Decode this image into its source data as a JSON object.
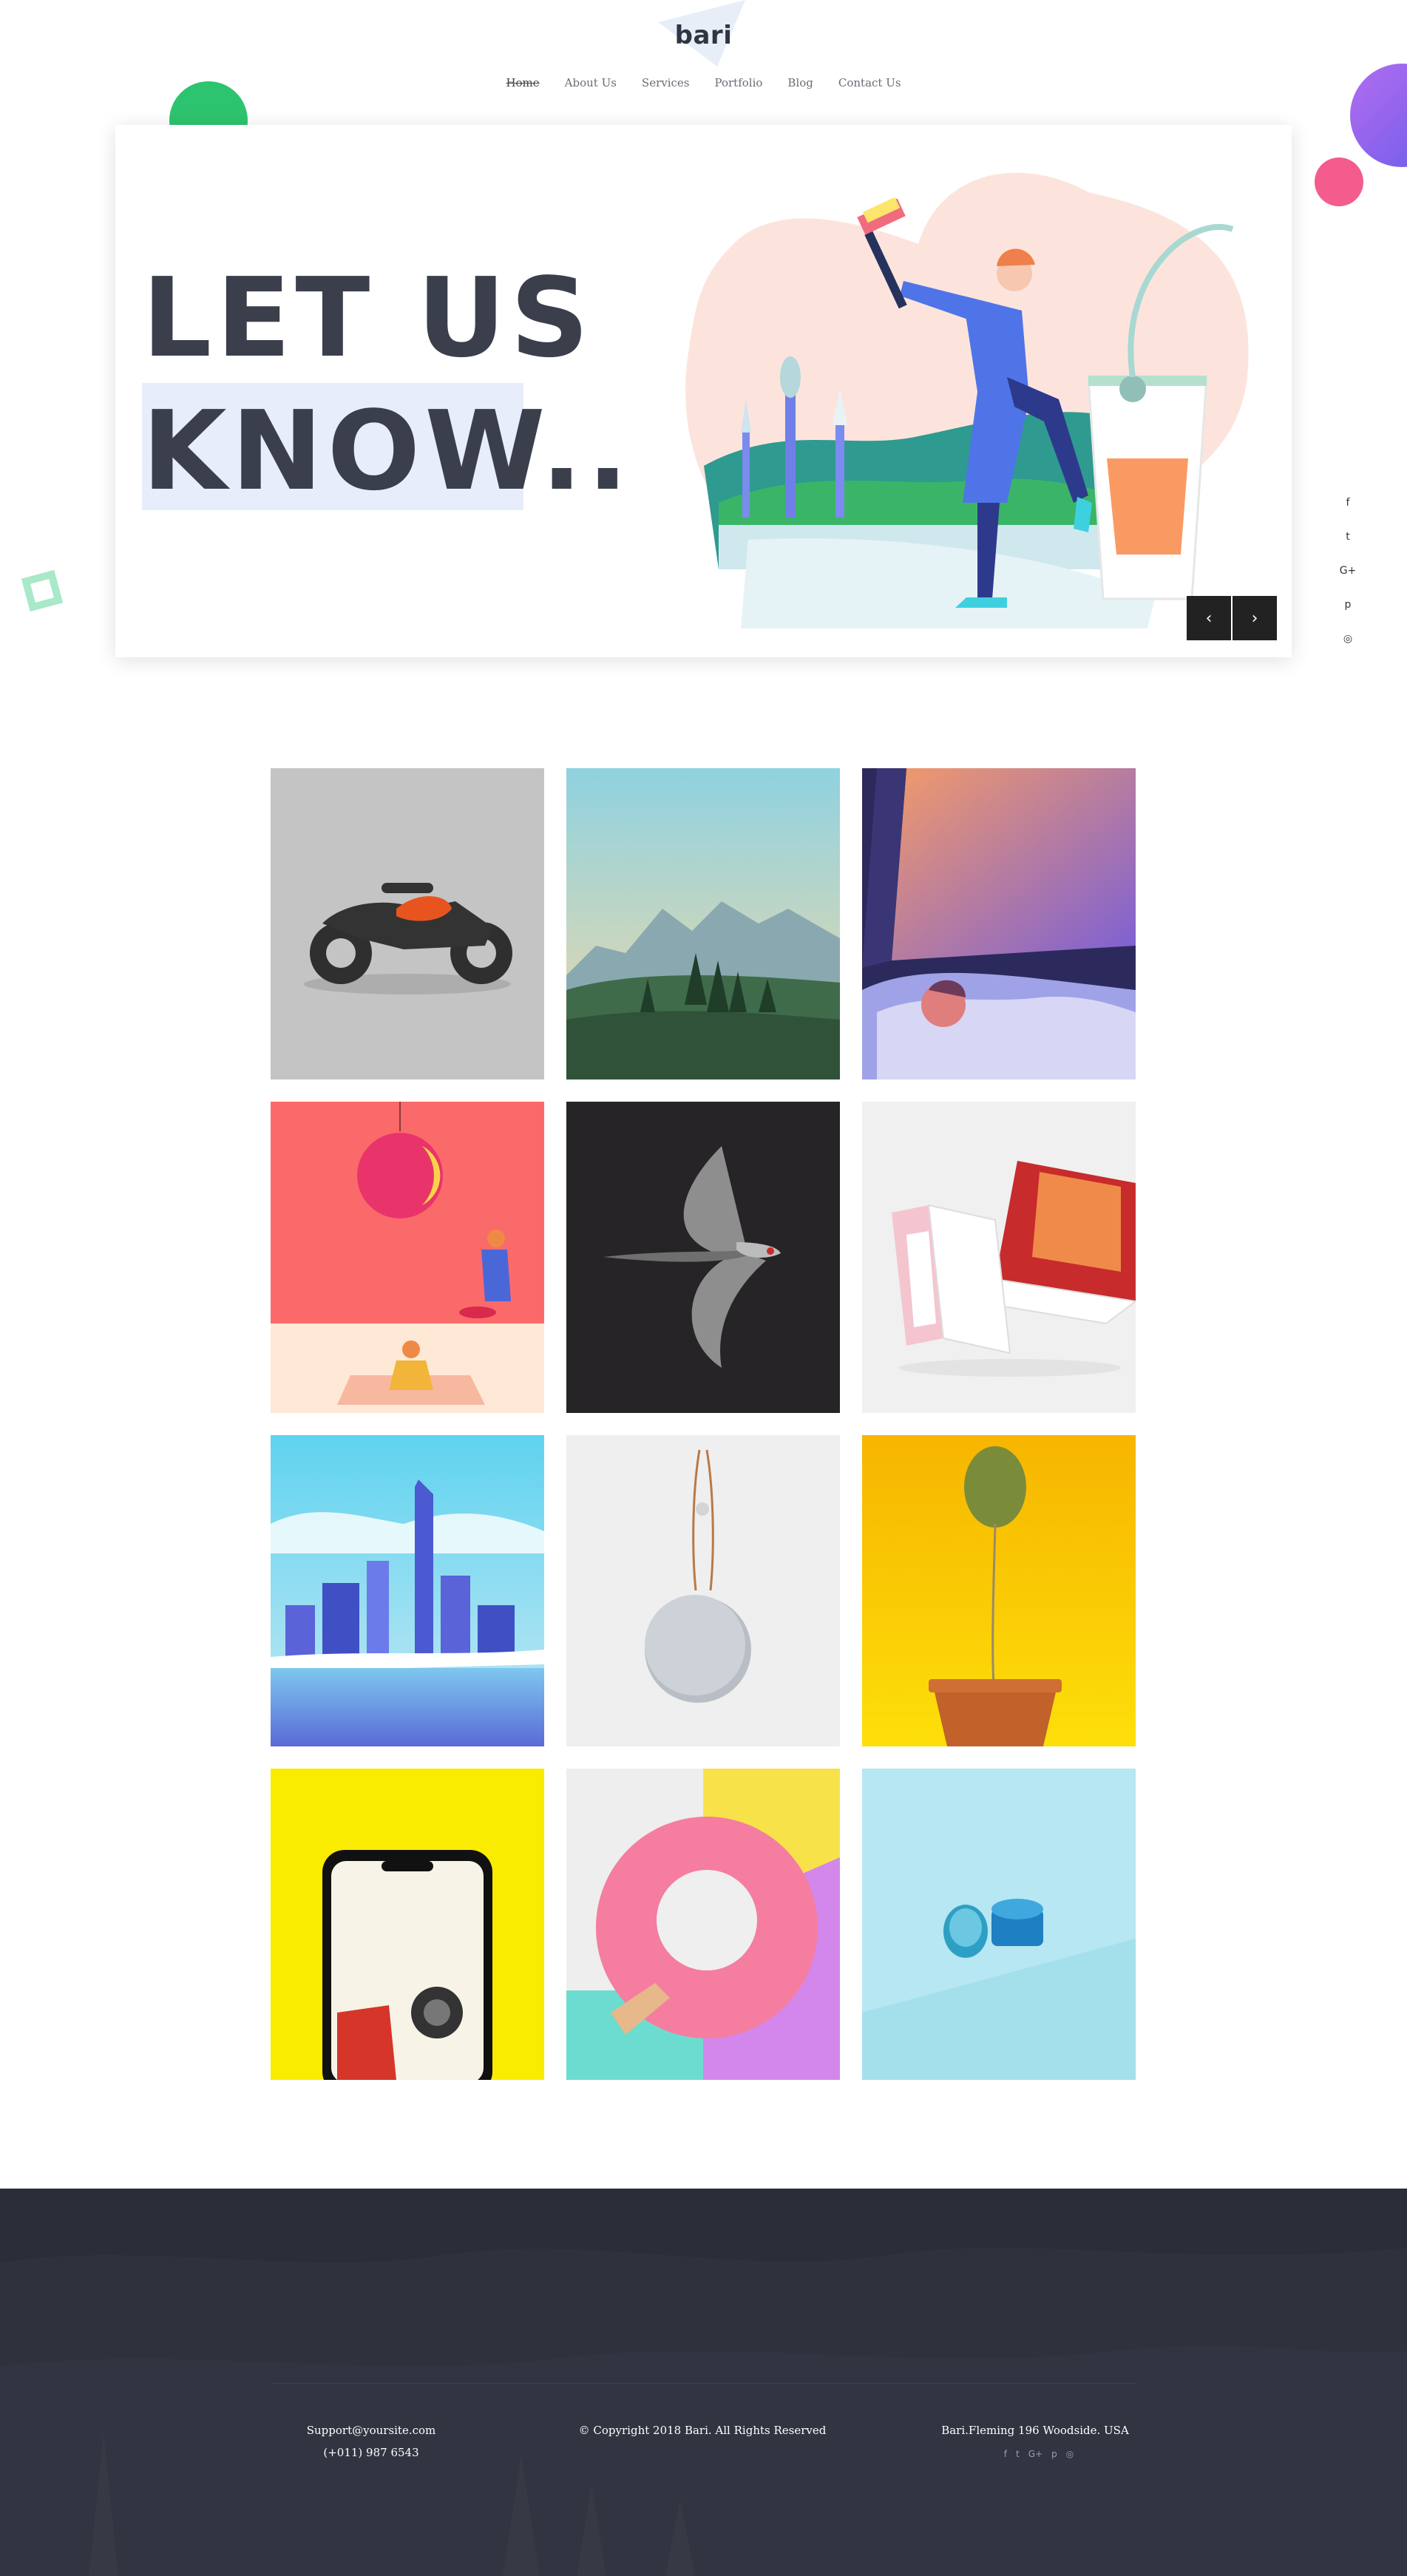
{
  "brand": {
    "logo": "bari"
  },
  "nav": {
    "items": [
      {
        "label": "Home",
        "active": true
      },
      {
        "label": "About Us"
      },
      {
        "label": "Services"
      },
      {
        "label": "Portfolio"
      },
      {
        "label": "Blog"
      },
      {
        "label": "Contact Us"
      }
    ]
  },
  "hero": {
    "line1": "LET US",
    "line2": "KNOW..",
    "prev_icon": "chevron-left-icon",
    "next_icon": "chevron-right-icon",
    "prev_glyph": "‹",
    "next_glyph": "›"
  },
  "social_sidebar": [
    {
      "icon": "facebook-icon",
      "glyph": "f"
    },
    {
      "icon": "twitter-icon",
      "glyph": "t"
    },
    {
      "icon": "google-plus-icon",
      "glyph": "G+"
    },
    {
      "icon": "pinterest-icon",
      "glyph": "p"
    },
    {
      "icon": "dribbble-icon",
      "glyph": "◎"
    }
  ],
  "gallery": [
    {
      "subject": "motorcycle-illustration"
    },
    {
      "subject": "mountain-landscape"
    },
    {
      "subject": "window-sleeper-illustration"
    },
    {
      "subject": "people-relaxing-illustration"
    },
    {
      "subject": "swallow-bird"
    },
    {
      "subject": "laptop-mockup"
    },
    {
      "subject": "city-skyline-illustration"
    },
    {
      "subject": "bluetooth-speaker"
    },
    {
      "subject": "cactus-in-pot"
    },
    {
      "subject": "phone-mockup"
    },
    {
      "subject": "pink-plate-abstract"
    },
    {
      "subject": "blue-boxes-render"
    }
  ],
  "footer": {
    "email": "Support@yoursite.com",
    "phone": "(+011) 987 6543",
    "copyright": "© Copyright 2018 Bari. All Rights Reserved",
    "address": "Bari.Fleming 196 Woodside. USA",
    "social": [
      {
        "icon": "facebook-icon",
        "glyph": "f"
      },
      {
        "icon": "twitter-icon",
        "glyph": "t"
      },
      {
        "icon": "google-plus-icon",
        "glyph": "G+"
      },
      {
        "icon": "pinterest-icon",
        "glyph": "p"
      },
      {
        "icon": "dribbble-icon",
        "glyph": "◎"
      }
    ]
  },
  "colors": {
    "accent_green": "#2dc46f",
    "accent_purple": "#8b5cf0",
    "accent_pink": "#f35c8d",
    "footer_bg": "#2a2e38",
    "heading": "#3b3f4c"
  }
}
